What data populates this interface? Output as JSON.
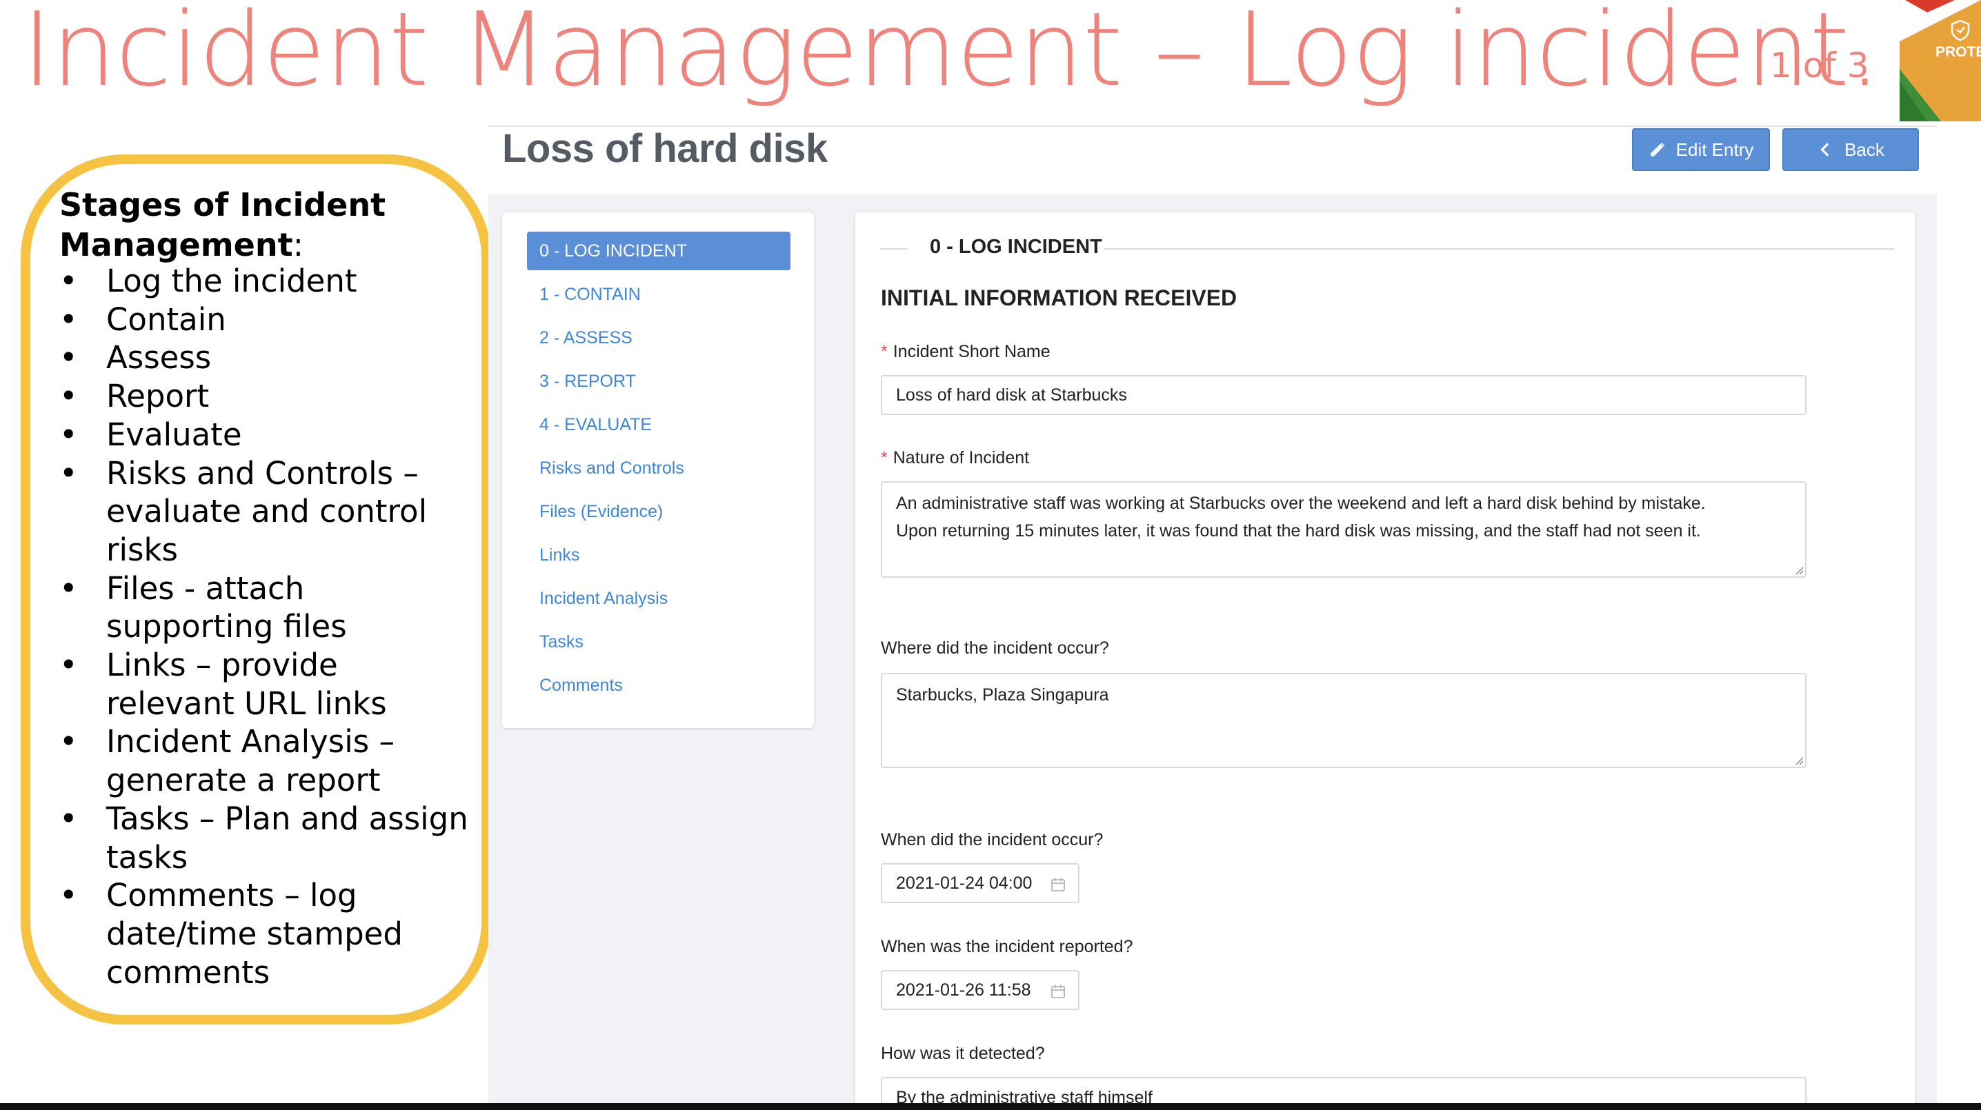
{
  "slide": {
    "title": "Incident Management – Log incident.",
    "page_counter": "1 of 3",
    "badge_text": "PROTECT",
    "colors": {
      "title": "#ee837b",
      "box_border": "#f5c242",
      "primary": "#5a8ed6"
    }
  },
  "stages": {
    "heading": "Stages of Incident Management",
    "heading_suffix": ":",
    "bullet": "•",
    "items": [
      "Log the incident",
      "Contain",
      "Assess",
      "Report",
      "Evaluate",
      "Risks and Controls – evaluate and control risks",
      "Files - attach supporting files",
      "Links – provide relevant URL links",
      "Incident Analysis – generate a report",
      "Tasks – Plan and assign tasks",
      "Comments – log date/time stamped comments"
    ]
  },
  "header": {
    "entry_title": "Loss of hard disk",
    "edit_label": "Edit Entry",
    "back_label": "Back"
  },
  "nav": {
    "items": [
      {
        "label": "0 - LOG INCIDENT",
        "active": true
      },
      {
        "label": "1 - CONTAIN"
      },
      {
        "label": "2 - ASSESS"
      },
      {
        "label": "3 - REPORT"
      },
      {
        "label": "4 - EVALUATE"
      },
      {
        "label": "Risks and Controls"
      },
      {
        "label": "Files (Evidence)"
      },
      {
        "label": "Links"
      },
      {
        "label": "Incident Analysis"
      },
      {
        "label": "Tasks"
      },
      {
        "label": "Comments"
      }
    ]
  },
  "form": {
    "legend": "0 - LOG INCIDENT",
    "section_title": "INITIAL INFORMATION RECEIVED",
    "required_mark": "*",
    "short_name": {
      "label": "Incident Short Name",
      "value": "Loss of hard disk at Starbucks"
    },
    "nature": {
      "label": "Nature of Incident",
      "line1": "An administrative staff was working at Starbucks over the weekend and left a hard disk behind by mistake.",
      "line2": "Upon returning 15 minutes later, it was found that the hard disk was missing, and the staff had not seen it."
    },
    "location": {
      "label": "Where did the incident occur?",
      "value": "Starbucks, Plaza Singapura"
    },
    "occurred": {
      "label": "When did the incident occur?",
      "value": "2021-01-24 04:00"
    },
    "reported": {
      "label": "When was the incident reported?",
      "value": "2021-01-26 11:58"
    },
    "detected": {
      "label": "How was it detected?",
      "value": "By the administrative staff himself"
    }
  }
}
